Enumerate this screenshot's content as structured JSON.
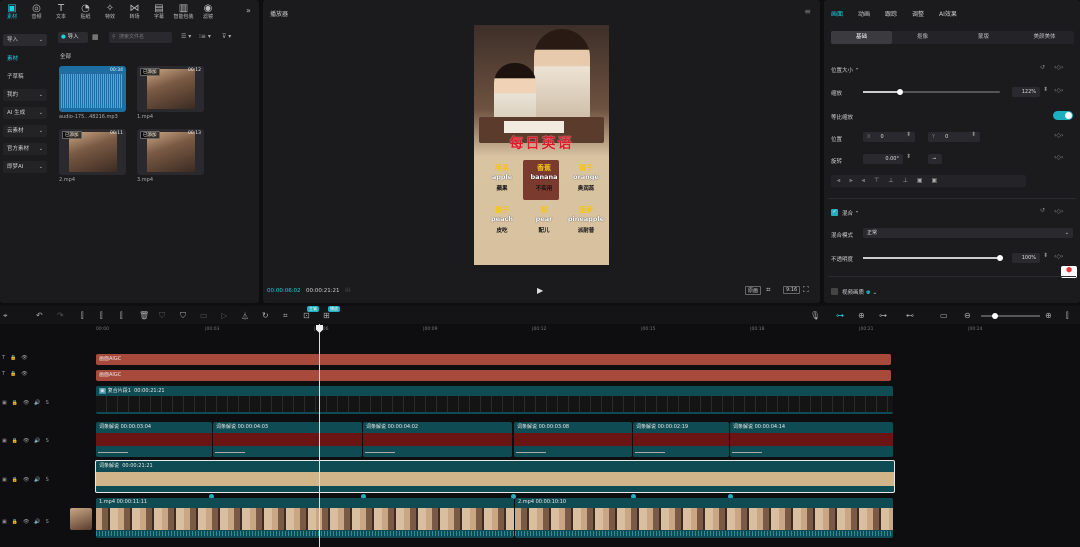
{
  "toolbar": {
    "tools": [
      {
        "label": "素材",
        "icon": "media-icon",
        "active": true
      },
      {
        "label": "音频",
        "icon": "audio-icon"
      },
      {
        "label": "文本",
        "icon": "text-icon"
      },
      {
        "label": "贴纸",
        "icon": "sticker-icon"
      },
      {
        "label": "特效",
        "icon": "effect-icon"
      },
      {
        "label": "转场",
        "icon": "transition-icon"
      },
      {
        "label": "字幕",
        "icon": "subtitle-icon"
      },
      {
        "label": "智能包装",
        "icon": "smart-pack-icon"
      },
      {
        "label": "滤镜",
        "icon": "filter-icon"
      }
    ],
    "more": "»"
  },
  "media_sidebar": {
    "items": [
      {
        "label": "导入",
        "active": true,
        "chevron": true
      },
      {
        "label": "素材",
        "active": false,
        "accent": true
      },
      {
        "label": "子草稿"
      },
      {
        "label": "我的",
        "chevron": true
      },
      {
        "label": "AI 生成",
        "chevron": true
      },
      {
        "label": "云素材",
        "chevron": true
      },
      {
        "label": "官方素材",
        "chevron": true
      },
      {
        "label": "即梦AI",
        "chevron": true
      }
    ]
  },
  "media_panel": {
    "import_label": "导入",
    "search_placeholder": "搜索文件名",
    "section_label": "全部",
    "items": [
      {
        "name": "audio-175...48216.mp3",
        "duration": "00:34",
        "tag": "",
        "type": "audio"
      },
      {
        "name": "1.mp4",
        "duration": "00:12",
        "tag": "已添加",
        "type": "video"
      },
      {
        "name": "2.mp4",
        "duration": "00:11",
        "tag": "已添加",
        "type": "video"
      },
      {
        "name": "3.mp4",
        "duration": "00:13",
        "tag": "已添加",
        "type": "video"
      }
    ]
  },
  "player": {
    "title": "播放器",
    "preview": {
      "headline": "每日英语",
      "words": [
        {
          "cn": "苹果",
          "en": "apple",
          "cn2": "蘋果"
        },
        {
          "cn": "香蕉",
          "en": "banana",
          "cn2": "不实用"
        },
        {
          "cn": "橘子",
          "en": "orange",
          "cn2": "奥润蕊"
        },
        {
          "cn": "桃子",
          "en": "peach",
          "cn2": "皮吃"
        },
        {
          "cn": "梨",
          "en": "pear",
          "cn2": "配儿"
        },
        {
          "cn": "菠萝",
          "en": "pineapple",
          "cn2": "派耐普"
        }
      ]
    },
    "current_time": "00:00:06:02",
    "total_time": "00:00:21:21",
    "quality_label": "原画",
    "ratio_label": "9:16"
  },
  "inspector": {
    "tabs": [
      "画面",
      "动画",
      "跟踪",
      "调整",
      "AI效果"
    ],
    "subtabs": [
      "基础",
      "抠像",
      "蒙版",
      "美颜美体"
    ],
    "position_size_label": "位置大小",
    "scale_label": "缩放",
    "scale_value": "122%",
    "scale_fraction": 0.27,
    "uniform_scale_label": "等比缩放",
    "position_label": "位置",
    "pos_x_label": "X",
    "pos_x": "0",
    "pos_y_label": "Y",
    "pos_y": "0",
    "rotate_label": "旋转",
    "rotate_value": "0.00°",
    "blend_label": "混合",
    "blend_mode_label": "混合模式",
    "blend_mode_value": "正常",
    "opacity_label": "不透明度",
    "opacity_value": "100%",
    "opacity_fraction": 1.0,
    "stabilize_label": "视频画质"
  },
  "timeline": {
    "ruler": [
      "00:00",
      "|00:03",
      "|00:06",
      "|00:09",
      "|00:12",
      "|00:15",
      "|00:18",
      "|00:21",
      "|00:24"
    ],
    "tracks": {
      "text1": "画面AIGC",
      "text2": "画面AIGC",
      "compound_label": "复合片段1",
      "compound_duration": "00:00:21:21",
      "subtitle_clips": [
        {
          "label": "词条解说",
          "duration": "00:00:03:04"
        },
        {
          "label": "词条解说",
          "duration": "00:00:04:03"
        },
        {
          "label": "词条解说",
          "duration": "00:00:04:02"
        },
        {
          "label": "词条解说",
          "duration": "00:00:03:08"
        },
        {
          "label": "词条解说",
          "duration": "00:00:02:19"
        },
        {
          "label": "词条解说",
          "duration": "00:00:04:14"
        }
      ],
      "bg_label": "词条解说",
      "bg_duration": "00:00:21:21",
      "video_clips": [
        {
          "label": "1.mp4",
          "duration": "00:00:11:11"
        },
        {
          "label": "2.mp4",
          "duration": "00:00:10:10"
        }
      ]
    },
    "playhead_badges": [
      "主轴",
      "播放"
    ]
  }
}
